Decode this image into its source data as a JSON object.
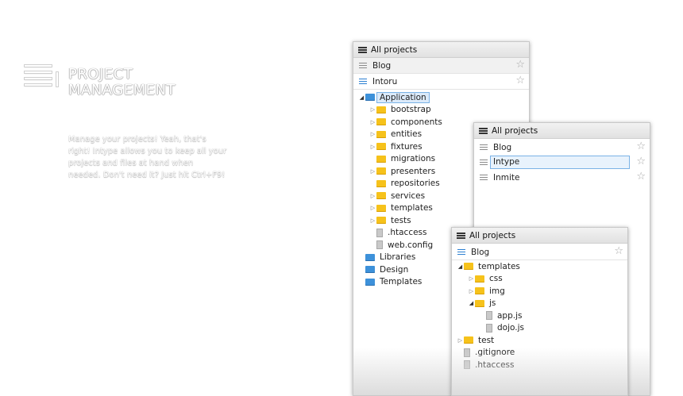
{
  "hero": {
    "title_line1": "PROJECT",
    "title_line2": "MANAGEMENT",
    "description": "Manage your projects! Yeah, that's right! Intype allows you to keep all your projects and files at hand when needed. Don't need it? Just hit Ctrl+F9!"
  },
  "panel1": {
    "header": "All projects",
    "projects": [
      "Blog",
      "Intoru"
    ],
    "tree": [
      {
        "label": "Application",
        "kind": "folder-blue",
        "depth": 0,
        "arrow": "open",
        "selected": true
      },
      {
        "label": "bootstrap",
        "kind": "folder",
        "depth": 1,
        "arrow": "closed"
      },
      {
        "label": "components",
        "kind": "folder",
        "depth": 1,
        "arrow": "closed"
      },
      {
        "label": "entities",
        "kind": "folder",
        "depth": 1,
        "arrow": "closed"
      },
      {
        "label": "fixtures",
        "kind": "folder",
        "depth": 1,
        "arrow": "closed"
      },
      {
        "label": "migrations",
        "kind": "folder",
        "depth": 1,
        "arrow": "none"
      },
      {
        "label": "presenters",
        "kind": "folder",
        "depth": 1,
        "arrow": "closed"
      },
      {
        "label": "repositories",
        "kind": "folder",
        "depth": 1,
        "arrow": "none"
      },
      {
        "label": "services",
        "kind": "folder",
        "depth": 1,
        "arrow": "closed"
      },
      {
        "label": "templates",
        "kind": "folder",
        "depth": 1,
        "arrow": "closed"
      },
      {
        "label": "tests",
        "kind": "folder",
        "depth": 1,
        "arrow": "closed"
      },
      {
        "label": ".htaccess",
        "kind": "file",
        "depth": 1,
        "arrow": "none"
      },
      {
        "label": "web.config",
        "kind": "file",
        "depth": 1,
        "arrow": "none"
      },
      {
        "label": "Libraries",
        "kind": "folder-blue",
        "depth": 0,
        "arrow": "none"
      },
      {
        "label": "Design",
        "kind": "folder-blue",
        "depth": 0,
        "arrow": "none"
      },
      {
        "label": "Templates",
        "kind": "folder-blue",
        "depth": 0,
        "arrow": "none"
      }
    ]
  },
  "panel2": {
    "header": "All projects",
    "projects": [
      "Blog",
      "Intype",
      "Inmite"
    ],
    "selected": "Intype"
  },
  "panel3": {
    "header": "All projects",
    "project": "Blog",
    "tree": [
      {
        "label": "templates",
        "kind": "folder",
        "depth": 0,
        "arrow": "open"
      },
      {
        "label": "css",
        "kind": "folder",
        "depth": 1,
        "arrow": "closed"
      },
      {
        "label": "img",
        "kind": "folder",
        "depth": 1,
        "arrow": "closed"
      },
      {
        "label": "js",
        "kind": "folder",
        "depth": 1,
        "arrow": "open"
      },
      {
        "label": "app.js",
        "kind": "file",
        "depth": 2,
        "arrow": "none"
      },
      {
        "label": "dojo.js",
        "kind": "file",
        "depth": 2,
        "arrow": "none"
      },
      {
        "label": "test",
        "kind": "folder",
        "depth": 0,
        "arrow": "closed"
      },
      {
        "label": ".gitignore",
        "kind": "file",
        "depth": 0,
        "arrow": "none"
      },
      {
        "label": ".htaccess",
        "kind": "file",
        "depth": 0,
        "arrow": "none"
      }
    ]
  }
}
